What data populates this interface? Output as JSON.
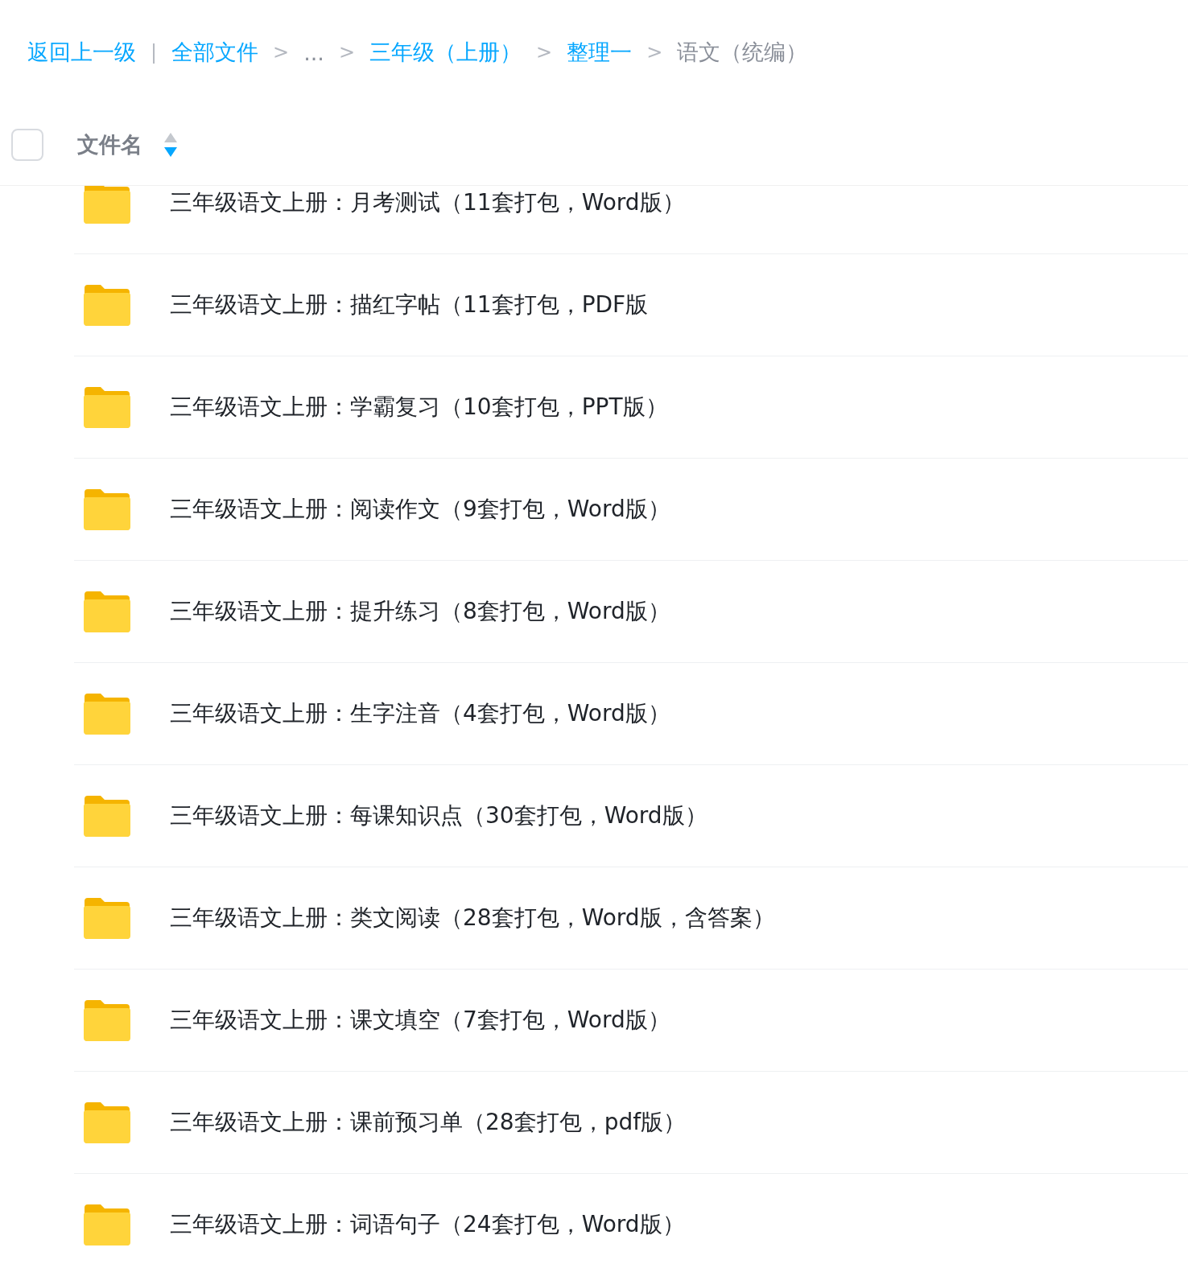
{
  "breadcrumb": {
    "back": "返回上一级",
    "divider": "|",
    "items": [
      {
        "label": "全部文件",
        "kind": "link"
      },
      {
        "separator": ">",
        "label": "...",
        "kind": "ellipsis"
      },
      {
        "separator": ">",
        "label": "三年级（上册）",
        "kind": "link"
      },
      {
        "separator": ">",
        "label": "整理一",
        "kind": "link"
      },
      {
        "separator": ">",
        "label": "语文（统编）",
        "kind": "current"
      }
    ]
  },
  "header": {
    "select_all": {
      "checked": false
    },
    "column": {
      "label": "文件名",
      "sort_descending": true
    }
  },
  "files": [
    {
      "name": "三年级语文上册：月考测试（11套打包，Word版）",
      "kind": "folder"
    },
    {
      "name": "三年级语文上册：描红字帖（11套打包，PDF版",
      "kind": "folder"
    },
    {
      "name": "三年级语文上册：学霸复习（10套打包，PPT版）",
      "kind": "folder"
    },
    {
      "name": "三年级语文上册：阅读作文（9套打包，Word版）",
      "kind": "folder"
    },
    {
      "name": "三年级语文上册：提升练习（8套打包，Word版）",
      "kind": "folder"
    },
    {
      "name": "三年级语文上册：生字注音（4套打包，Word版）",
      "kind": "folder"
    },
    {
      "name": "三年级语文上册：每课知识点（30套打包，Word版）",
      "kind": "folder"
    },
    {
      "name": "三年级语文上册：类文阅读（28套打包，Word版，含答案）",
      "kind": "folder"
    },
    {
      "name": "三年级语文上册：课文填空（7套打包，Word版）",
      "kind": "folder"
    },
    {
      "name": "三年级语文上册：课前预习单（28套打包，pdf版）",
      "kind": "folder"
    },
    {
      "name": "三年级语文上册：词语句子（24套打包，Word版）",
      "kind": "folder"
    }
  ]
}
